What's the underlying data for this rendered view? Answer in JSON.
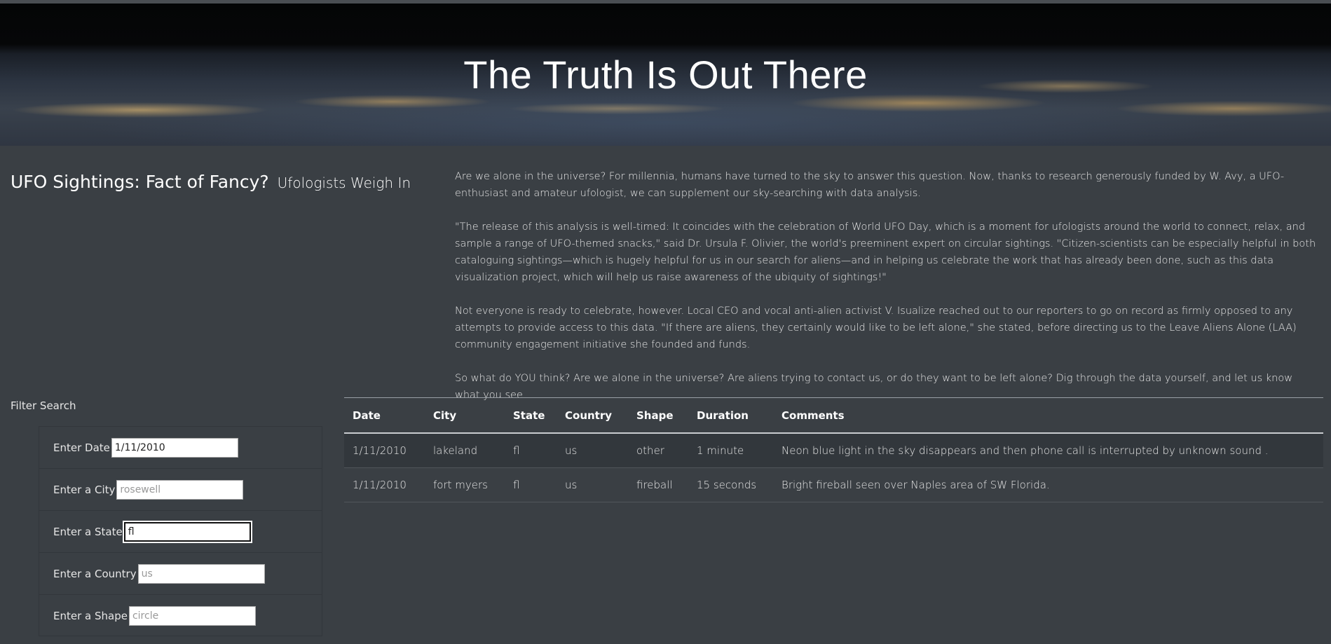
{
  "hero": {
    "title": "The Truth Is Out There"
  },
  "heading": {
    "main": "UFO Sightings: Fact of Fancy?",
    "small": "Ufologists Weigh In"
  },
  "article": {
    "paragraphs": [
      "Are we alone in the universe? For millennia, humans have turned to the sky to answer this question. Now, thanks to research generously funded by W. Avy, a UFO-enthusiast and amateur ufologist, we can supplement our sky-searching with data analysis.",
      "\"The release of this analysis is well-timed: It coincides with the celebration of World UFO Day, which is a moment for ufologists around the world to connect, relax, and sample a range of UFO-themed snacks,\" said Dr. Ursula F. Olivier, the world's preeminent expert on circular sightings. \"Citizen-scientists can be especially helpful in both cataloguing sightings—which is hugely helpful for us in our search for aliens—and in helping us celebrate the work that has already been done, such as this data visualization project, which will help us raise awareness of the ubiquity of sightings!\"",
      "Not everyone is ready to celebrate, however. Local CEO and vocal anti-alien activist V. Isualize reached out to our reporters to go on record as firmly opposed to any attempts to provide access to this data. \"If there are aliens, they certainly would like to be left alone,\" she stated, before directing us to the Leave Aliens Alone (LAA) community engagement initiative she founded and funds.",
      "So what do YOU think? Are we alone in the universe? Are aliens trying to contact us, or do they want to be left alone? Dig through the data yourself, and let us know what you see."
    ]
  },
  "filters": {
    "title": "Filter Search",
    "date": {
      "label": "Enter Date",
      "value": "1/11/2010",
      "placeholder": ""
    },
    "city": {
      "label": "Enter a City",
      "value": "",
      "placeholder": "rosewell"
    },
    "state": {
      "label": "Enter a State",
      "value": "fl",
      "placeholder": ""
    },
    "country": {
      "label": "Enter a Country",
      "value": "",
      "placeholder": "us"
    },
    "shape": {
      "label": "Enter a Shape",
      "value": "",
      "placeholder": "circle"
    }
  },
  "table": {
    "headers": [
      "Date",
      "City",
      "State",
      "Country",
      "Shape",
      "Duration",
      "Comments"
    ],
    "rows": [
      [
        "1/11/2010",
        "lakeland",
        "fl",
        "us",
        "other",
        "1 minute",
        "Neon blue light in the sky disappears and then phone call is interrupted by unknown sound ."
      ],
      [
        "1/11/2010",
        "fort myers",
        "fl",
        "us",
        "fireball",
        "15 seconds",
        "Bright fireball seen over Naples area of SW Florida."
      ]
    ]
  }
}
